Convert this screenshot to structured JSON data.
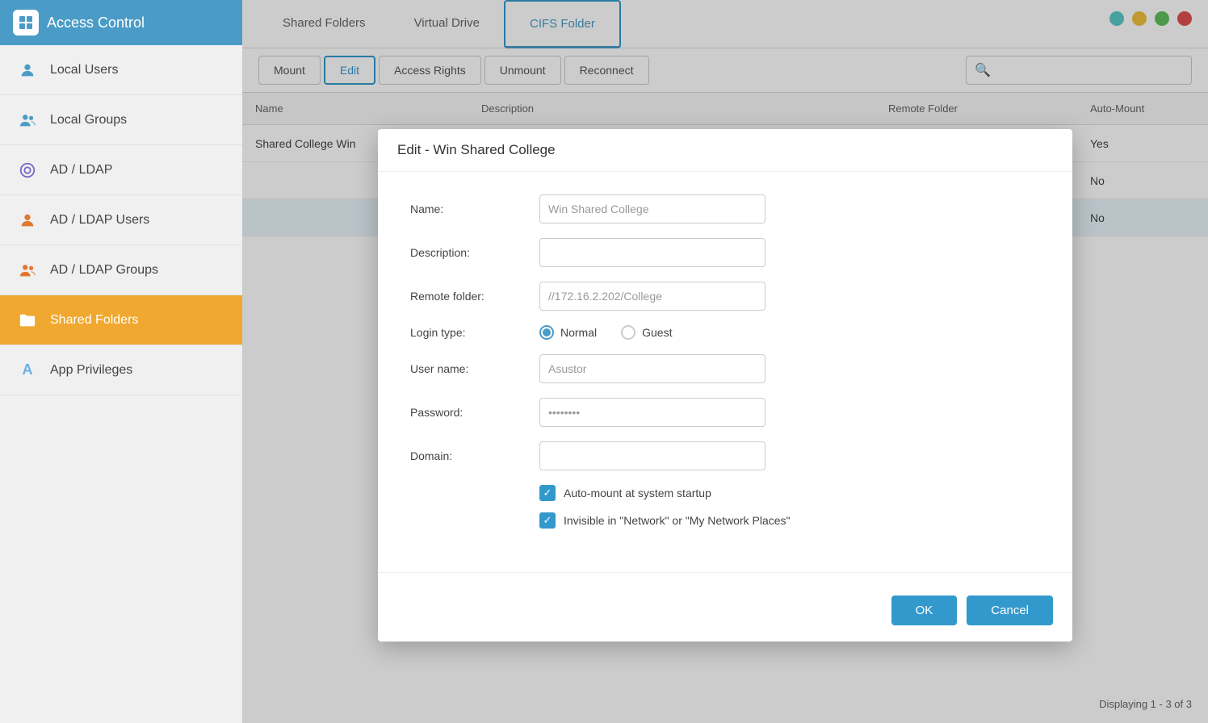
{
  "app": {
    "title": "Access Control"
  },
  "window_controls": {
    "teal": "teal",
    "yellow": "yellow",
    "green": "green",
    "red": "red"
  },
  "sidebar": {
    "items": [
      {
        "id": "local-users",
        "label": "Local Users",
        "icon": "👤",
        "active": false
      },
      {
        "id": "local-groups",
        "label": "Local Groups",
        "icon": "👥",
        "active": false
      },
      {
        "id": "ad-ldap",
        "label": "AD / LDAP",
        "icon": "🔑",
        "active": false
      },
      {
        "id": "ad-ldap-users",
        "label": "AD / LDAP Users",
        "icon": "👤",
        "active": false
      },
      {
        "id": "ad-ldap-groups",
        "label": "AD / LDAP Groups",
        "icon": "👥",
        "active": false
      },
      {
        "id": "shared-folders",
        "label": "Shared Folders",
        "icon": "📁",
        "active": true
      },
      {
        "id": "app-privileges",
        "label": "App Privileges",
        "icon": "🅐",
        "active": false
      }
    ]
  },
  "top_tabs": [
    {
      "id": "shared-folders-tab",
      "label": "Shared Folders",
      "active": false
    },
    {
      "id": "virtual-drive-tab",
      "label": "Virtual Drive",
      "active": false
    },
    {
      "id": "cifs-folder-tab",
      "label": "CIFS Folder",
      "active": true
    }
  ],
  "toolbar": {
    "buttons": [
      {
        "id": "mount-btn",
        "label": "Mount",
        "active": false
      },
      {
        "id": "edit-btn",
        "label": "Edit",
        "active": true
      },
      {
        "id": "access-rights-btn",
        "label": "Access Rights",
        "active": false
      },
      {
        "id": "unmount-btn",
        "label": "Unmount",
        "active": false
      },
      {
        "id": "reconnect-btn",
        "label": "Reconnect",
        "active": false
      }
    ],
    "search_placeholder": ""
  },
  "table": {
    "headers": [
      {
        "id": "col-name",
        "label": "Name"
      },
      {
        "id": "col-desc",
        "label": "Description"
      },
      {
        "id": "col-remote",
        "label": "Remote Folder"
      },
      {
        "id": "col-automount",
        "label": "Auto-Mount"
      }
    ],
    "rows": [
      {
        "name": "Shared College Win",
        "description": "",
        "remote": "",
        "automount": "Yes"
      },
      {
        "name": "",
        "description": "",
        "remote": "",
        "automount": "No"
      },
      {
        "name": "",
        "description": "",
        "remote": "",
        "automount": "No"
      }
    ],
    "pagination": "Displaying 1 - 3 of 3"
  },
  "modal": {
    "title": "Edit - Win Shared College",
    "fields": {
      "name_label": "Name:",
      "name_value": "Win Shared College",
      "description_label": "Description:",
      "description_value": "",
      "remote_folder_label": "Remote folder:",
      "remote_folder_value": "//172.16.2.202/College",
      "login_type_label": "Login type:",
      "login_type_normal": "Normal",
      "login_type_guest": "Guest",
      "username_label": "User name:",
      "username_value": "Asustor",
      "password_label": "Password:",
      "password_value": "••••••••",
      "domain_label": "Domain:",
      "domain_value": ""
    },
    "checkboxes": [
      {
        "id": "auto-mount-cb",
        "label": "Auto-mount at system startup",
        "checked": true
      },
      {
        "id": "invisible-cb",
        "label": "Invisible in \"Network\" or \"My Network Places\"",
        "checked": true
      }
    ],
    "buttons": {
      "ok": "OK",
      "cancel": "Cancel"
    }
  }
}
